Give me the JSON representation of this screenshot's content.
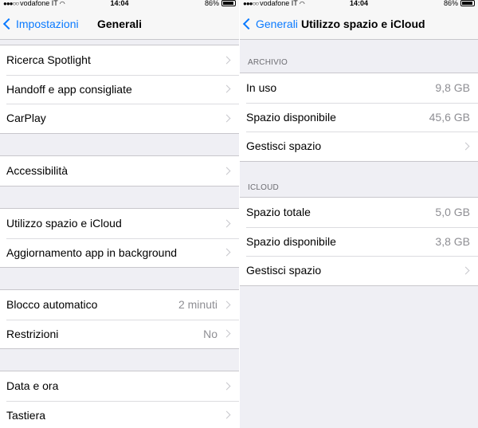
{
  "left": {
    "status": {
      "carrier": "vodafone IT",
      "time": "14:04",
      "battery": "86%"
    },
    "nav": {
      "back_label": "Impostazioni",
      "title": "Generali"
    },
    "groups": [
      {
        "items": [
          {
            "label": "Ricerca Spotlight"
          },
          {
            "label": "Handoff e app consigliate"
          },
          {
            "label": "CarPlay"
          }
        ]
      },
      {
        "items": [
          {
            "label": "Accessibilità"
          }
        ]
      },
      {
        "items": [
          {
            "label": "Utilizzo spazio e iCloud"
          },
          {
            "label": "Aggiornamento app in background"
          }
        ]
      },
      {
        "items": [
          {
            "label": "Blocco automatico",
            "value": "2 minuti"
          },
          {
            "label": "Restrizioni",
            "value": "No"
          }
        ]
      },
      {
        "items": [
          {
            "label": "Data e ora"
          },
          {
            "label": "Tastiera"
          }
        ]
      }
    ]
  },
  "right": {
    "status": {
      "carrier": "vodafone IT",
      "time": "14:04",
      "battery": "86%"
    },
    "nav": {
      "back_label": "Generali",
      "title": "Utilizzo spazio e iCloud"
    },
    "sections": [
      {
        "header": "ARCHIVIO",
        "items": [
          {
            "label": "In uso",
            "value": "9,8 GB"
          },
          {
            "label": "Spazio disponibile",
            "value": "45,6 GB"
          },
          {
            "label": "Gestisci spazio"
          }
        ]
      },
      {
        "header": "ICLOUD",
        "items": [
          {
            "label": "Spazio totale",
            "value": "5,0 GB"
          },
          {
            "label": "Spazio disponibile",
            "value": "3,8 GB"
          },
          {
            "label": "Gestisci spazio"
          }
        ]
      }
    ]
  },
  "colors": {
    "accent": "#0a7aff",
    "background": "#efeff4",
    "secondary_text": "#8e8e93"
  }
}
